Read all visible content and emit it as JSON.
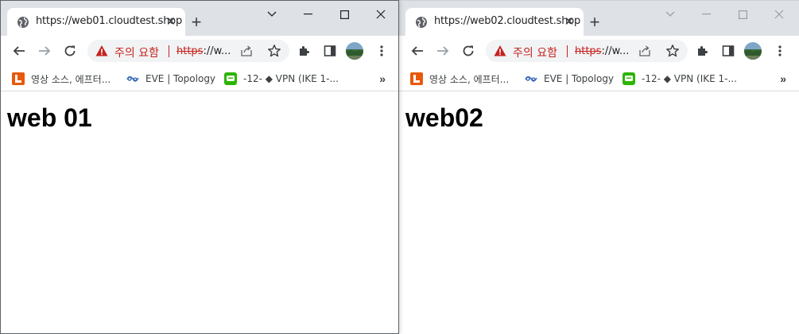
{
  "windows": [
    {
      "tab_title": "https://web01.cloudtest.shop",
      "security_warning": "주의 요함",
      "url_scheme": "https",
      "url_rest": "://w...",
      "bookmarks": [
        {
          "label": "영상 소스, 에프터...",
          "icon": "orange-bookmark-icon",
          "color": "#e8590c"
        },
        {
          "label": "EVE | Topology",
          "icon": "eve-icon",
          "color": "#5b8fd6"
        },
        {
          "label": "-12- ◆ VPN (IKE 1-...",
          "icon": "green-chat-icon",
          "color": "#2db400"
        }
      ],
      "more_bookmarks": "»",
      "heading": "web 01"
    },
    {
      "tab_title": "https://web02.cloudtest.shop",
      "security_warning": "주의 요함",
      "url_scheme": "https",
      "url_rest": "://w...",
      "bookmarks": [
        {
          "label": "영상 소스, 에프터...",
          "icon": "orange-bookmark-icon",
          "color": "#e8590c"
        },
        {
          "label": "EVE | Topology",
          "icon": "eve-icon",
          "color": "#5b8fd6"
        },
        {
          "label": "-12- ◆ VPN (IKE 1-...",
          "icon": "green-chat-icon",
          "color": "#2db400"
        }
      ],
      "more_bookmarks": "»",
      "heading": "web02"
    }
  ],
  "colors": {
    "titlebar": "#dee1e6",
    "warning_red": "#c5221f",
    "omnibox": "#f1f3f4"
  }
}
